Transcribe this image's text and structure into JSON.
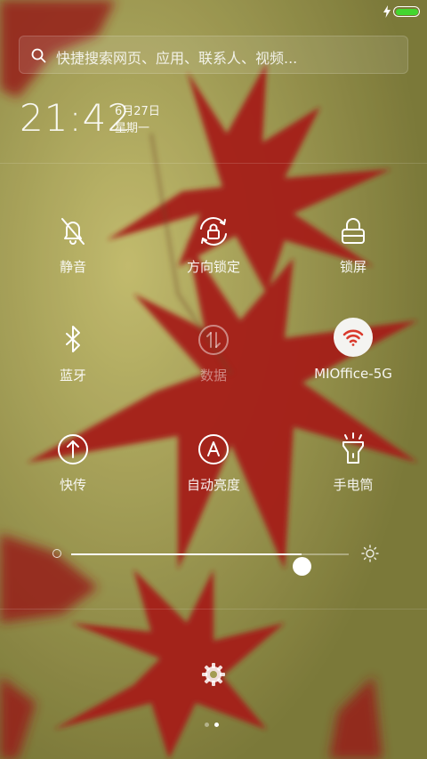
{
  "status_bar": {
    "charging_icon": "lightning-icon",
    "battery_color": "#43d62f"
  },
  "search": {
    "placeholder": "快捷搜索网页、应用、联系人、视频..."
  },
  "clock": {
    "time": "21:42",
    "date": "6月27日",
    "weekday": "星期一"
  },
  "tiles": [
    {
      "label": "静音",
      "icon": "mute-bell-icon",
      "active": false
    },
    {
      "label": "方向锁定",
      "icon": "rotation-lock-icon",
      "active": false
    },
    {
      "label": "锁屏",
      "icon": "lock-icon",
      "active": false
    },
    {
      "label": "蓝牙",
      "icon": "bluetooth-icon",
      "active": false
    },
    {
      "label": "数据",
      "icon": "mobile-data-icon",
      "active": false,
      "disabled": true
    },
    {
      "label": "MIOffice-5G",
      "icon": "wifi-icon",
      "active": true
    },
    {
      "label": "快传",
      "icon": "quick-transfer-icon",
      "active": false
    },
    {
      "label": "自动亮度",
      "icon": "auto-brightness-icon",
      "active": false
    },
    {
      "label": "手电筒",
      "icon": "flashlight-icon",
      "active": false
    }
  ],
  "brightness": {
    "level": 0.83
  },
  "settings": {
    "icon": "gear-icon"
  },
  "pager": {
    "pages": 2,
    "current": 2
  }
}
